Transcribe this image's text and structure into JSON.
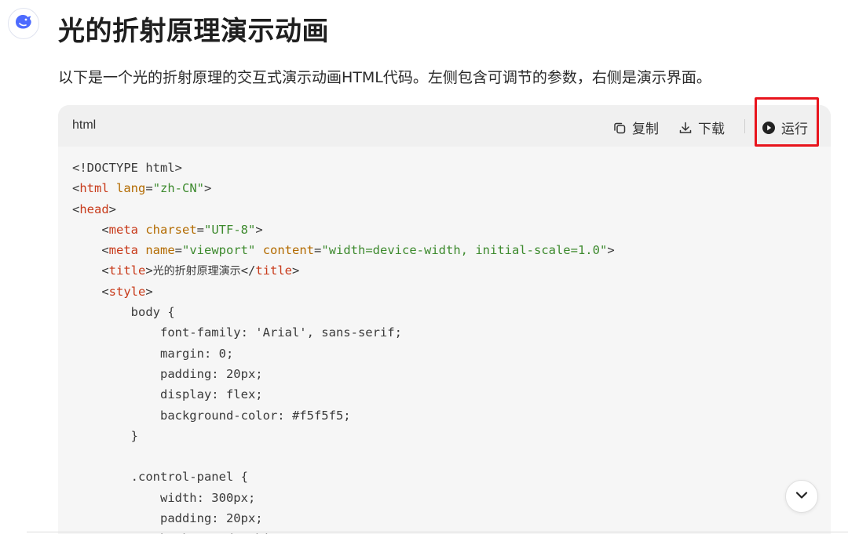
{
  "message": {
    "avatar_icon": "deepseek-whale-icon",
    "title": "光的折射原理演示动画",
    "intro": "以下是一个光的折射原理的交互式演示动画HTML代码。左侧包含可调节的参数，右侧是演示界面。"
  },
  "code_block": {
    "language": "html",
    "copy_label": "复制",
    "download_label": "下载",
    "run_label": "运行",
    "highlight_color": "#e8141c",
    "lines": [
      [
        {
          "t": "<!DOCTYPE html>",
          "c": "plain"
        }
      ],
      [
        {
          "t": "<",
          "c": "plain"
        },
        {
          "t": "html",
          "c": "tag"
        },
        {
          "t": " ",
          "c": "plain"
        },
        {
          "t": "lang",
          "c": "attr"
        },
        {
          "t": "=",
          "c": "plain"
        },
        {
          "t": "\"zh-CN\"",
          "c": "str"
        },
        {
          "t": ">",
          "c": "plain"
        }
      ],
      [
        {
          "t": "<",
          "c": "plain"
        },
        {
          "t": "head",
          "c": "tag"
        },
        {
          "t": ">",
          "c": "plain"
        }
      ],
      [
        {
          "t": "    <",
          "c": "plain"
        },
        {
          "t": "meta",
          "c": "tag"
        },
        {
          "t": " ",
          "c": "plain"
        },
        {
          "t": "charset",
          "c": "attr"
        },
        {
          "t": "=",
          "c": "plain"
        },
        {
          "t": "\"UTF-8\"",
          "c": "str"
        },
        {
          "t": ">",
          "c": "plain"
        }
      ],
      [
        {
          "t": "    <",
          "c": "plain"
        },
        {
          "t": "meta",
          "c": "tag"
        },
        {
          "t": " ",
          "c": "plain"
        },
        {
          "t": "name",
          "c": "attr"
        },
        {
          "t": "=",
          "c": "plain"
        },
        {
          "t": "\"viewport\"",
          "c": "str"
        },
        {
          "t": " ",
          "c": "plain"
        },
        {
          "t": "content",
          "c": "attr"
        },
        {
          "t": "=",
          "c": "plain"
        },
        {
          "t": "\"width=device-width, initial-scale=1.0\"",
          "c": "str"
        },
        {
          "t": ">",
          "c": "plain"
        }
      ],
      [
        {
          "t": "    <",
          "c": "plain"
        },
        {
          "t": "title",
          "c": "tag"
        },
        {
          "t": ">",
          "c": "plain"
        },
        {
          "t": "光的折射原理演示",
          "c": "cn"
        },
        {
          "t": "</",
          "c": "plain"
        },
        {
          "t": "title",
          "c": "tag"
        },
        {
          "t": ">",
          "c": "plain"
        }
      ],
      [
        {
          "t": "    <",
          "c": "plain"
        },
        {
          "t": "style",
          "c": "tag"
        },
        {
          "t": ">",
          "c": "plain"
        }
      ],
      [
        {
          "t": "        body {",
          "c": "plain"
        }
      ],
      [
        {
          "t": "            font-family: 'Arial', sans-serif;",
          "c": "plain"
        }
      ],
      [
        {
          "t": "            margin: 0;",
          "c": "plain"
        }
      ],
      [
        {
          "t": "            padding: 20px;",
          "c": "plain"
        }
      ],
      [
        {
          "t": "            display: flex;",
          "c": "plain"
        }
      ],
      [
        {
          "t": "            background-color: #f5f5f5;",
          "c": "plain"
        }
      ],
      [
        {
          "t": "        }",
          "c": "plain"
        }
      ],
      [
        {
          "t": "",
          "c": "plain"
        }
      ],
      [
        {
          "t": "        .control-panel {",
          "c": "plain"
        }
      ],
      [
        {
          "t": "            width: 300px;",
          "c": "plain"
        }
      ],
      [
        {
          "t": "            padding: 20px;",
          "c": "plain"
        }
      ],
      [
        {
          "t": "            background: white;",
          "c": "plain"
        }
      ]
    ]
  },
  "scroll_button_icon": "chevron-down-icon"
}
